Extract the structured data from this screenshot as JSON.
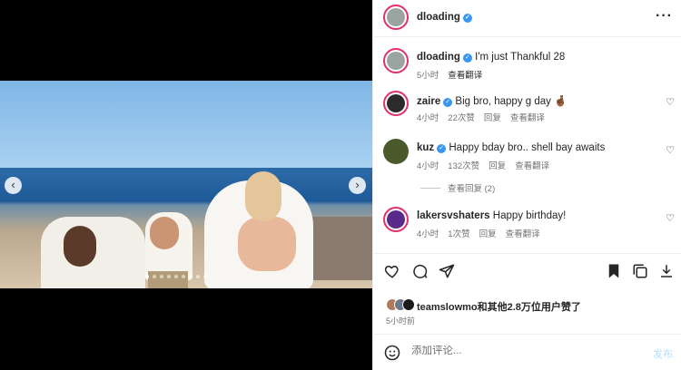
{
  "post": {
    "author": "dloading",
    "caption": "I'm just Thankful 28",
    "caption_time": "5小时",
    "translate": "查看翻译",
    "nav_prev": "‹",
    "nav_next": "›"
  },
  "comments": [
    {
      "user": "zaire",
      "verified": true,
      "text": "Big bro, happy g day 🤞🏾",
      "time": "4小时",
      "likes": "22次赞",
      "reply": "回复",
      "translate": "查看翻译",
      "avatar_color": "#2b2b2b"
    },
    {
      "user": "kuz",
      "verified": true,
      "text": "Happy bday bro.. shell bay awaits",
      "time": "4小时",
      "likes": "132次赞",
      "reply": "回复",
      "translate": "查看翻译",
      "avatar_color": "#4a5a2a"
    },
    {
      "user": "lakersvshaters",
      "verified": false,
      "text": "Happy birthday!",
      "time": "4小时",
      "likes": "1次赞",
      "reply": "回复",
      "translate": "查看翻译",
      "avatar_color": "#5a2a8a"
    }
  ],
  "view_replies": "查看回复 (2)",
  "liked_by": "teamslowmo和其他2.8万位用户赞了",
  "post_time": "5小时前",
  "composer": {
    "placeholder": "添加评论...",
    "post_label": "发布"
  },
  "icons": {
    "more": "more-icon",
    "emoji": "emoji-icon"
  },
  "colors": {
    "accent": "#3897f0",
    "ring": "#e1306c",
    "post_disabled": "#b2dffc"
  }
}
